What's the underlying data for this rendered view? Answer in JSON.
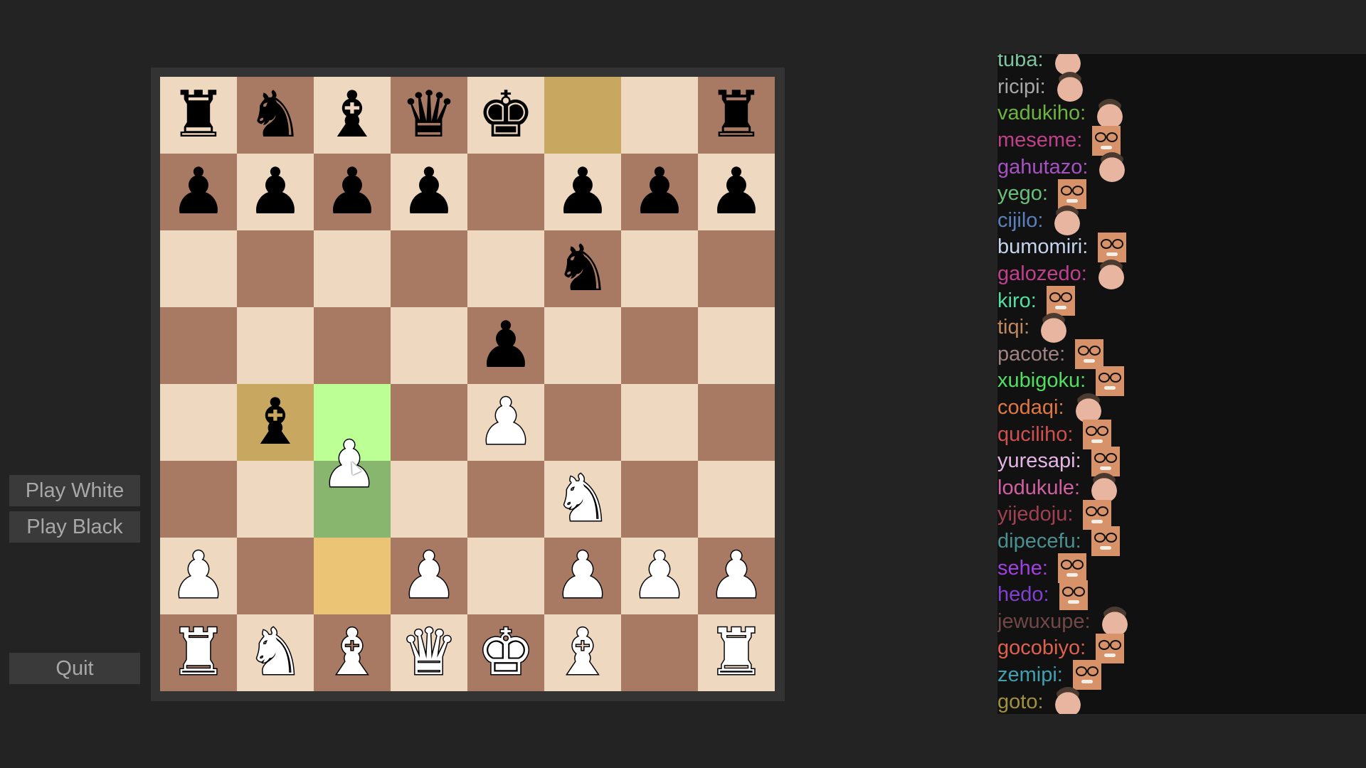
{
  "menu": {
    "play_white": "Play White",
    "play_black": "Play Black",
    "quit": "Quit"
  },
  "colors": {
    "background": "#232323",
    "frame": "#333333",
    "light": "#efd8c0",
    "dark": "#a87a64",
    "last_move_from": "#c8a860",
    "last_move_to": "#c8a860",
    "selected": "#bcff95",
    "hover_target": "#88b66e",
    "legal_origin": "#ebc476",
    "chat_bg": "#111111"
  },
  "board": {
    "ranks": [
      [
        "bR",
        "bN",
        "bB",
        "bQ",
        "bK",
        "",
        "",
        "bR"
      ],
      [
        "bP",
        "bP",
        "bP",
        "bP",
        "",
        "bP",
        "bP",
        "bP"
      ],
      [
        "",
        "",
        "",
        "",
        "",
        "bN",
        "",
        ""
      ],
      [
        "",
        "",
        "",
        "",
        "bP",
        "",
        "",
        ""
      ],
      [
        "",
        "bB",
        "",
        "",
        "wP",
        "",
        "",
        ""
      ],
      [
        "",
        "",
        "",
        "",
        "",
        "wN",
        "",
        ""
      ],
      [
        "wP",
        "",
        "",
        "wP",
        "",
        "wP",
        "wP",
        "wP"
      ],
      [
        "wR",
        "wN",
        "wB",
        "wQ",
        "wK",
        "wB",
        "",
        "wR"
      ]
    ],
    "highlights": {
      "f8": "last_move_from",
      "b4": "last_move_to",
      "c4": "selected",
      "c3": "hover_target",
      "c2": "legal_origin"
    },
    "dragging_piece": "wP"
  },
  "chat": [
    {
      "name": "tuba:",
      "color": "#7fc4a0",
      "face": "man"
    },
    {
      "name": "ricipi:",
      "color": "#a6a6a6",
      "face": "man"
    },
    {
      "name": "vadukiho:",
      "color": "#6db33f",
      "face": "man"
    },
    {
      "name": "meseme:",
      "color": "#c0408a",
      "face": "woman"
    },
    {
      "name": "gahutazo:",
      "color": "#a652c4",
      "face": "man"
    },
    {
      "name": "yego:",
      "color": "#6abf7a",
      "face": "woman"
    },
    {
      "name": "cijilo:",
      "color": "#5a80c0",
      "face": "man"
    },
    {
      "name": "bumomiri:",
      "color": "#c4d4ec",
      "face": "woman"
    },
    {
      "name": "galozedo:",
      "color": "#c0408e",
      "face": "man"
    },
    {
      "name": "kiro:",
      "color": "#50e0a0",
      "face": "woman"
    },
    {
      "name": "tiqi:",
      "color": "#c08860",
      "face": "man"
    },
    {
      "name": "pacote:",
      "color": "#a08282",
      "face": "woman"
    },
    {
      "name": "xubigoku:",
      "color": "#50e060",
      "face": "woman"
    },
    {
      "name": "codaqi:",
      "color": "#e07840",
      "face": "man"
    },
    {
      "name": "quciliho:",
      "color": "#d05050",
      "face": "woman"
    },
    {
      "name": "yuresapi:",
      "color": "#e4b4e4",
      "face": "woman"
    },
    {
      "name": "lodukule:",
      "color": "#d060a0",
      "face": "man"
    },
    {
      "name": "yijedoju:",
      "color": "#a04050",
      "face": "woman"
    },
    {
      "name": "dipecefu:",
      "color": "#4a9090",
      "face": "woman"
    },
    {
      "name": "sehe:",
      "color": "#a040e0",
      "face": "woman"
    },
    {
      "name": "hedo:",
      "color": "#8040d0",
      "face": "woman"
    },
    {
      "name": "jewuxupe:",
      "color": "#704848",
      "face": "man"
    },
    {
      "name": "gocobiyo:",
      "color": "#e06050",
      "face": "woman"
    },
    {
      "name": "zemipi:",
      "color": "#40a0b0",
      "face": "woman"
    },
    {
      "name": "goto:",
      "color": "#a09040",
      "face": "man"
    }
  ]
}
